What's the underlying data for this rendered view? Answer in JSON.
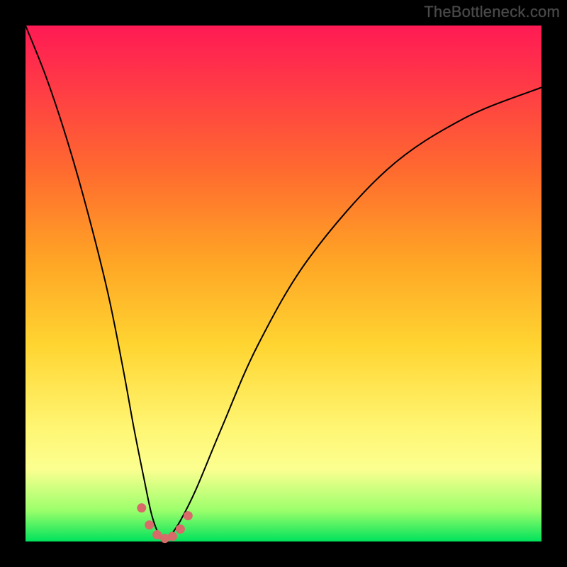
{
  "watermark": "TheBottleneck.com",
  "chart_data": {
    "type": "line",
    "title": "",
    "xlabel": "",
    "ylabel": "",
    "xlim": [
      0,
      100
    ],
    "ylim": [
      0,
      100
    ],
    "curve": {
      "x": [
        0,
        4,
        8,
        12,
        16,
        19,
        21,
        23,
        24.5,
        26,
        27,
        28,
        30,
        33,
        38,
        45,
        55,
        70,
        85,
        100
      ],
      "y": [
        100,
        90,
        78,
        64,
        48,
        33,
        22,
        12,
        5,
        1,
        0,
        1,
        4,
        10,
        22,
        38,
        55,
        72,
        82,
        88
      ]
    },
    "markers": {
      "x": [
        22.5,
        24.0,
        25.5,
        27.0,
        28.5,
        30.0,
        31.5
      ],
      "y": [
        6.5,
        3.2,
        1.3,
        0.6,
        1.0,
        2.4,
        5.0
      ]
    },
    "background_gradient": {
      "top": "#ff1a54",
      "bottom": "#00e25c"
    }
  }
}
